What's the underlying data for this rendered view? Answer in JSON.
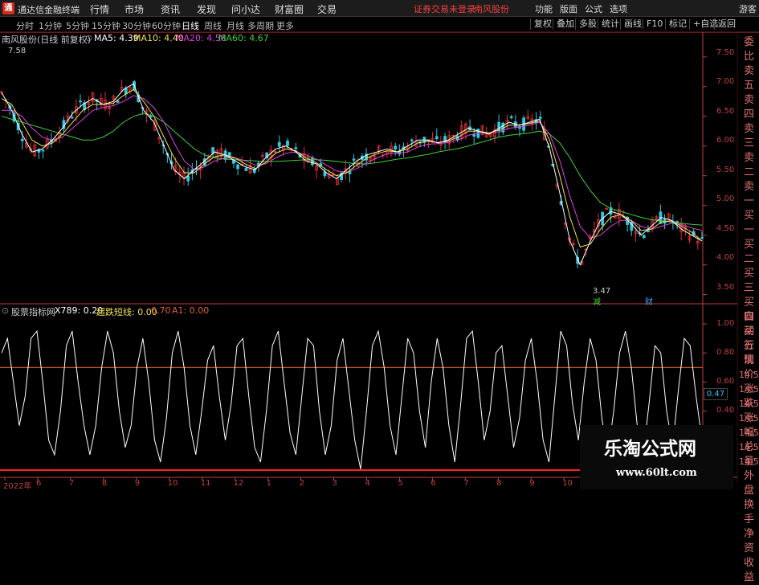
{
  "app": {
    "title": "通达信金融终端",
    "menus": [
      "行情",
      "市场",
      "资讯",
      "发现",
      "问小达",
      "财富圈",
      "交易"
    ],
    "notice": "证券交易未登录",
    "stock_tag": "南风股份",
    "right_menus": [
      "功能",
      "版面",
      "公式",
      "选项"
    ],
    "user": "游客"
  },
  "timeframes": [
    "分时",
    "1分钟",
    "5分钟",
    "15分钟",
    "30分钟",
    "60分钟",
    "日线",
    "周线",
    "月线",
    "多周期",
    "更多"
  ],
  "active_timeframe": "日线",
  "toolbar": [
    "复权",
    "叠加",
    "多股",
    "统计",
    "画线",
    "F10",
    "标记",
    "+自选",
    "返回"
  ],
  "main_chart": {
    "stock": "南风股份(日线 前复权)",
    "ma": [
      {
        "label": "MA5: 4.39",
        "color": "#ffffff"
      },
      {
        "label": "MA10: 4.40",
        "color": "#f0e050"
      },
      {
        "label": "MA20: 4.58",
        "color": "#e040e0"
      },
      {
        "label": "MA60: 4.67",
        "color": "#40d040"
      }
    ],
    "high_label": "7.58",
    "low_label": "3.47",
    "marker1": "减",
    "marker2": "财"
  },
  "chart_data": [
    {
      "type": "line",
      "title": "南风股份(日线 前复权)",
      "ylim": [
        3.4,
        7.7
      ],
      "yticks": [
        7.5,
        7.0,
        6.5,
        6.0,
        5.5,
        5.0,
        4.5,
        4.0,
        3.5
      ],
      "x_tick_labels": [
        "2022年",
        "6",
        "7",
        "8",
        "9",
        "10",
        "11",
        "12",
        "1",
        "2",
        "3",
        "4",
        "5",
        "6",
        "7",
        "8",
        "9",
        "10",
        "11",
        "12",
        "1",
        "2"
      ],
      "series": [
        {
          "name": "MA5",
          "color": "#ffffff",
          "values": [
            6.9,
            6.6,
            6.2,
            5.9,
            5.95,
            6.1,
            6.3,
            6.55,
            6.7,
            6.8,
            6.7,
            6.75,
            6.95,
            7.05,
            6.6,
            6.4,
            6.0,
            5.6,
            5.45,
            5.6,
            5.75,
            5.9,
            5.85,
            5.75,
            5.65,
            5.6,
            5.8,
            5.95,
            6.0,
            5.9,
            5.75,
            5.7,
            5.55,
            5.45,
            5.6,
            5.75,
            5.85,
            5.9,
            5.95,
            5.9,
            6.0,
            6.1,
            6.1,
            6.05,
            6.1,
            6.2,
            6.3,
            6.25,
            6.2,
            6.3,
            6.4,
            6.35,
            6.4,
            6.45,
            5.95,
            5.2,
            4.4,
            4.0,
            4.4,
            4.75,
            4.9,
            4.85,
            4.7,
            4.5,
            4.65,
            4.8,
            4.75,
            4.6,
            4.5,
            4.4
          ]
        },
        {
          "name": "MA10",
          "color": "#f0e050",
          "values": [
            6.8,
            6.7,
            6.4,
            6.1,
            6.0,
            6.05,
            6.2,
            6.4,
            6.6,
            6.7,
            6.7,
            6.72,
            6.85,
            6.95,
            6.75,
            6.5,
            6.15,
            5.8,
            5.55,
            5.55,
            5.7,
            5.82,
            5.85,
            5.8,
            5.7,
            5.62,
            5.72,
            5.88,
            5.95,
            5.92,
            5.8,
            5.72,
            5.6,
            5.5,
            5.55,
            5.68,
            5.8,
            5.87,
            5.92,
            5.9,
            5.95,
            6.05,
            6.08,
            6.06,
            6.08,
            6.15,
            6.25,
            6.25,
            6.22,
            6.27,
            6.35,
            6.35,
            6.38,
            6.42,
            6.1,
            5.5,
            4.8,
            4.3,
            4.35,
            4.6,
            4.8,
            4.85,
            4.75,
            4.58,
            4.6,
            4.72,
            4.74,
            4.65,
            4.55,
            4.4
          ]
        },
        {
          "name": "MA20",
          "color": "#e040e0",
          "values": [
            6.6,
            6.6,
            6.5,
            6.3,
            6.15,
            6.1,
            6.15,
            6.3,
            6.45,
            6.6,
            6.65,
            6.68,
            6.75,
            6.85,
            6.8,
            6.65,
            6.4,
            6.05,
            5.75,
            5.6,
            5.65,
            5.75,
            5.8,
            5.8,
            5.75,
            5.68,
            5.7,
            5.8,
            5.88,
            5.9,
            5.85,
            5.78,
            5.68,
            5.58,
            5.56,
            5.62,
            5.72,
            5.8,
            5.87,
            5.88,
            5.9,
            5.98,
            6.03,
            6.04,
            6.06,
            6.1,
            6.18,
            6.22,
            6.22,
            6.24,
            6.3,
            6.32,
            6.35,
            6.4,
            6.2,
            5.75,
            5.15,
            4.65,
            4.45,
            4.5,
            4.65,
            4.75,
            4.75,
            4.65,
            4.6,
            4.65,
            4.7,
            4.68,
            4.62,
            4.58
          ]
        },
        {
          "name": "MA60",
          "color": "#40d040",
          "values": [
            6.5,
            6.45,
            6.4,
            6.35,
            6.3,
            6.25,
            6.2,
            6.15,
            6.1,
            6.1,
            6.15,
            6.25,
            6.4,
            6.5,
            6.55,
            6.5,
            6.4,
            6.25,
            6.1,
            5.95,
            5.85,
            5.8,
            5.78,
            5.77,
            5.76,
            5.75,
            5.74,
            5.74,
            5.75,
            5.76,
            5.77,
            5.77,
            5.76,
            5.74,
            5.72,
            5.7,
            5.7,
            5.72,
            5.75,
            5.78,
            5.8,
            5.83,
            5.86,
            5.9,
            5.93,
            5.96,
            6.0,
            6.05,
            6.1,
            6.15,
            6.18,
            6.2,
            6.22,
            6.25,
            6.2,
            6.05,
            5.8,
            5.5,
            5.25,
            5.05,
            4.95,
            4.9,
            4.85,
            4.8,
            4.76,
            4.74,
            4.72,
            4.7,
            4.68,
            4.67
          ]
        }
      ]
    },
    {
      "type": "line",
      "title": "股票指标网",
      "ylim": [
        0,
        1.05
      ],
      "yticks": [
        1.0,
        0.8,
        0.6,
        0.4
      ],
      "reference_lines": [
        {
          "name": "超跌短线",
          "value": 0.7
        },
        {
          "name": "A1",
          "value": 0.0
        }
      ],
      "series": [
        {
          "name": "X789",
          "color": "#ffffff",
          "values": [
            0.8,
            0.9,
            0.6,
            0.3,
            0.5,
            0.9,
            0.95,
            0.6,
            0.2,
            0.1,
            0.4,
            0.85,
            0.95,
            0.6,
            0.3,
            0.1,
            0.3,
            0.7,
            0.95,
            0.8,
            0.4,
            0.15,
            0.3,
            0.7,
            0.9,
            0.6,
            0.2,
            0.05,
            0.35,
            0.8,
            0.95,
            0.7,
            0.3,
            0.1,
            0.4,
            0.75,
            0.85,
            0.5,
            0.2,
            0.45,
            0.85,
            0.9,
            0.5,
            0.15,
            0.05,
            0.4,
            0.85,
            0.95,
            0.6,
            0.25,
            0.1,
            0.5,
            0.9,
            0.85,
            0.4,
            0.1,
            0.3,
            0.75,
            0.9,
            0.55,
            0.2,
            0.0,
            0.4,
            0.85,
            0.95,
            0.7,
            0.3,
            0.1,
            0.5,
            0.9,
            0.8,
            0.4,
            0.15,
            0.6,
            0.9,
            0.7,
            0.3,
            0.05,
            0.45,
            0.9,
            0.95,
            0.6,
            0.2,
            0.4,
            0.8,
            0.85,
            0.5,
            0.15,
            0.35,
            0.75,
            0.9,
            0.6,
            0.2,
            0.05,
            0.5,
            0.95,
            0.85,
            0.45,
            0.2,
            0.6,
            0.9,
            0.75,
            0.35,
            0.1,
            0.4,
            0.8,
            0.95,
            0.7,
            0.3,
            0.1,
            0.45,
            0.85,
            0.8,
            0.4,
            0.15,
            0.55,
            0.9,
            0.85,
            0.5,
            0.2
          ]
        }
      ]
    }
  ],
  "sub_chart": {
    "name": "股票指标网",
    "x789": "X789: 0.20",
    "line_label": "超跌短线: 0.00",
    "level": "0.70",
    "a1": "A1: 0.00",
    "current_value": "0.47"
  },
  "price_axis": [
    "7.50",
    "7.00",
    "6.50",
    "6.00",
    "5.50",
    "5.00",
    "4.50",
    "4.00",
    "3.50"
  ],
  "sub_axis": [
    "1.00",
    "0.80",
    "0.60",
    "0.40"
  ],
  "x_axis": [
    "2022年",
    "6",
    "7",
    "8",
    "9",
    "10",
    "11",
    "12",
    "1",
    "2",
    "3",
    "4",
    "5",
    "6",
    "7",
    "8",
    "9",
    "10",
    "11",
    "12",
    "1",
    "2"
  ],
  "side_panel": [
    "委比",
    "卖五",
    "卖四",
    "卖三",
    "卖二",
    "卖一",
    "买一",
    "买二",
    "买三",
    "买四",
    "买五",
    "现价",
    "涨跌",
    "涨幅",
    "总量",
    "外盘",
    "换手",
    "净资",
    "收益"
  ],
  "side_panel_lower": [
    "自动",
    "行情",
    "14:50",
    "14:50",
    "14:50",
    "14:50",
    "14:50",
    "14:50",
    "14:50"
  ],
  "watermark": {
    "title": "乐淘公式网",
    "url": "www.60lt.com"
  },
  "colors": {
    "axis": "#c04040",
    "ref_line": "#e06030",
    "ma5": "#ffffff",
    "ma10": "#f0e050",
    "ma20": "#e040e0",
    "ma60": "#40d040"
  }
}
